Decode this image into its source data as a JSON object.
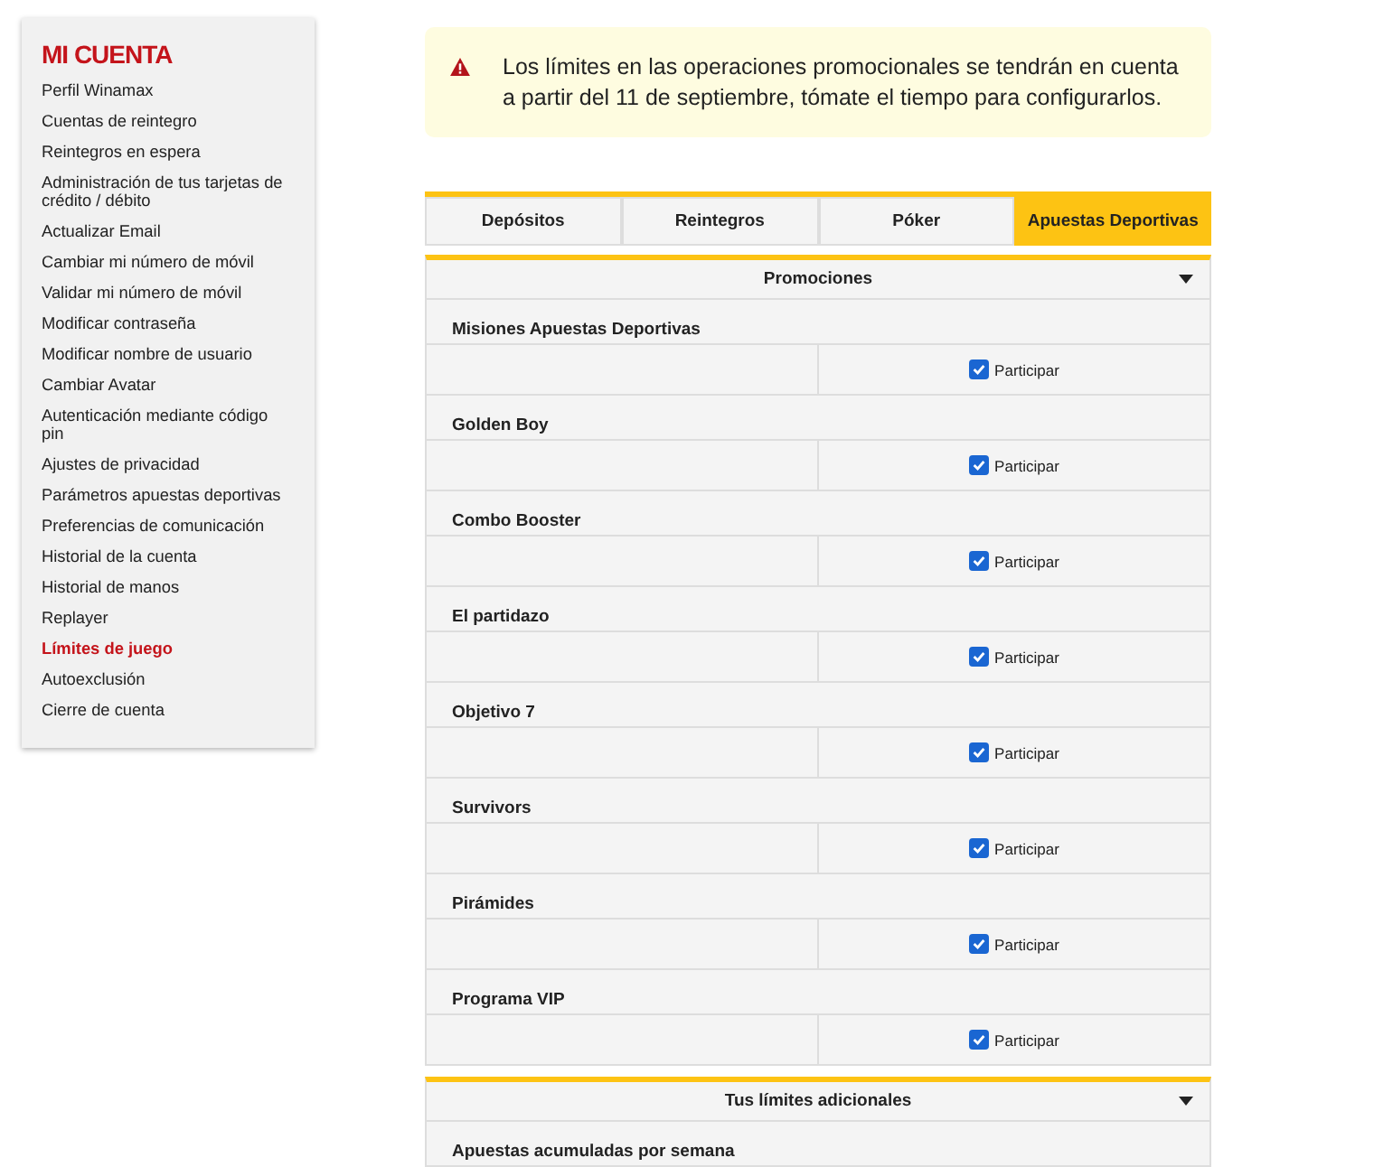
{
  "sidebar": {
    "title": "MI CUENTA",
    "items": [
      {
        "label": "Perfil Winamax",
        "selected": false
      },
      {
        "label": "Cuentas de reintegro",
        "selected": false
      },
      {
        "label": "Reintegros en espera",
        "selected": false
      },
      {
        "label": "Administración de tus tarjetas de crédito / débito",
        "selected": false
      },
      {
        "label": "Actualizar Email",
        "selected": false
      },
      {
        "label": "Cambiar mi número de móvil",
        "selected": false
      },
      {
        "label": "Validar mi número de móvil",
        "selected": false
      },
      {
        "label": "Modificar contraseña",
        "selected": false
      },
      {
        "label": "Modificar nombre de usuario",
        "selected": false
      },
      {
        "label": "Cambiar Avatar",
        "selected": false
      },
      {
        "label": "Autenticación mediante código pin",
        "selected": false
      },
      {
        "label": "Ajustes de privacidad",
        "selected": false
      },
      {
        "label": "Parámetros apuestas deportivas",
        "selected": false
      },
      {
        "label": "Preferencias de comunicación",
        "selected": false
      },
      {
        "label": "Historial de la cuenta",
        "selected": false
      },
      {
        "label": "Historial de manos",
        "selected": false
      },
      {
        "label": "Replayer",
        "selected": false
      },
      {
        "label": "Límites de juego",
        "selected": true
      },
      {
        "label": "Autoexclusión",
        "selected": false
      },
      {
        "label": "Cierre de cuenta",
        "selected": false
      }
    ]
  },
  "notice": {
    "text": "Los límites en las operaciones promocionales se tendrán en cuenta a partir del 11 de septiembre, tómate el tiempo para configurarlos."
  },
  "tabs": [
    {
      "label": "Depósitos",
      "selected": false
    },
    {
      "label": "Reintegros",
      "selected": false
    },
    {
      "label": "Póker",
      "selected": false
    },
    {
      "label": "Apuestas Deportivas",
      "selected": true
    }
  ],
  "promotions": {
    "title": "Promociones",
    "items": [
      {
        "name": "Misiones Apuestas Deportivas",
        "label": "Participar",
        "checked": true
      },
      {
        "name": "Golden Boy",
        "label": "Participar",
        "checked": true
      },
      {
        "name": "Combo Booster",
        "label": "Participar",
        "checked": true
      },
      {
        "name": "El partidazo",
        "label": "Participar",
        "checked": true
      },
      {
        "name": "Objetivo 7",
        "label": "Participar",
        "checked": true
      },
      {
        "name": "Survivors",
        "label": "Participar",
        "checked": true
      },
      {
        "name": "Pirámides",
        "label": "Participar",
        "checked": true
      },
      {
        "name": "Programa VIP",
        "label": "Participar",
        "checked": true
      }
    ]
  },
  "additional": {
    "title": "Tus límites adicionales",
    "first_row": "Apuestas acumuladas por semana"
  }
}
